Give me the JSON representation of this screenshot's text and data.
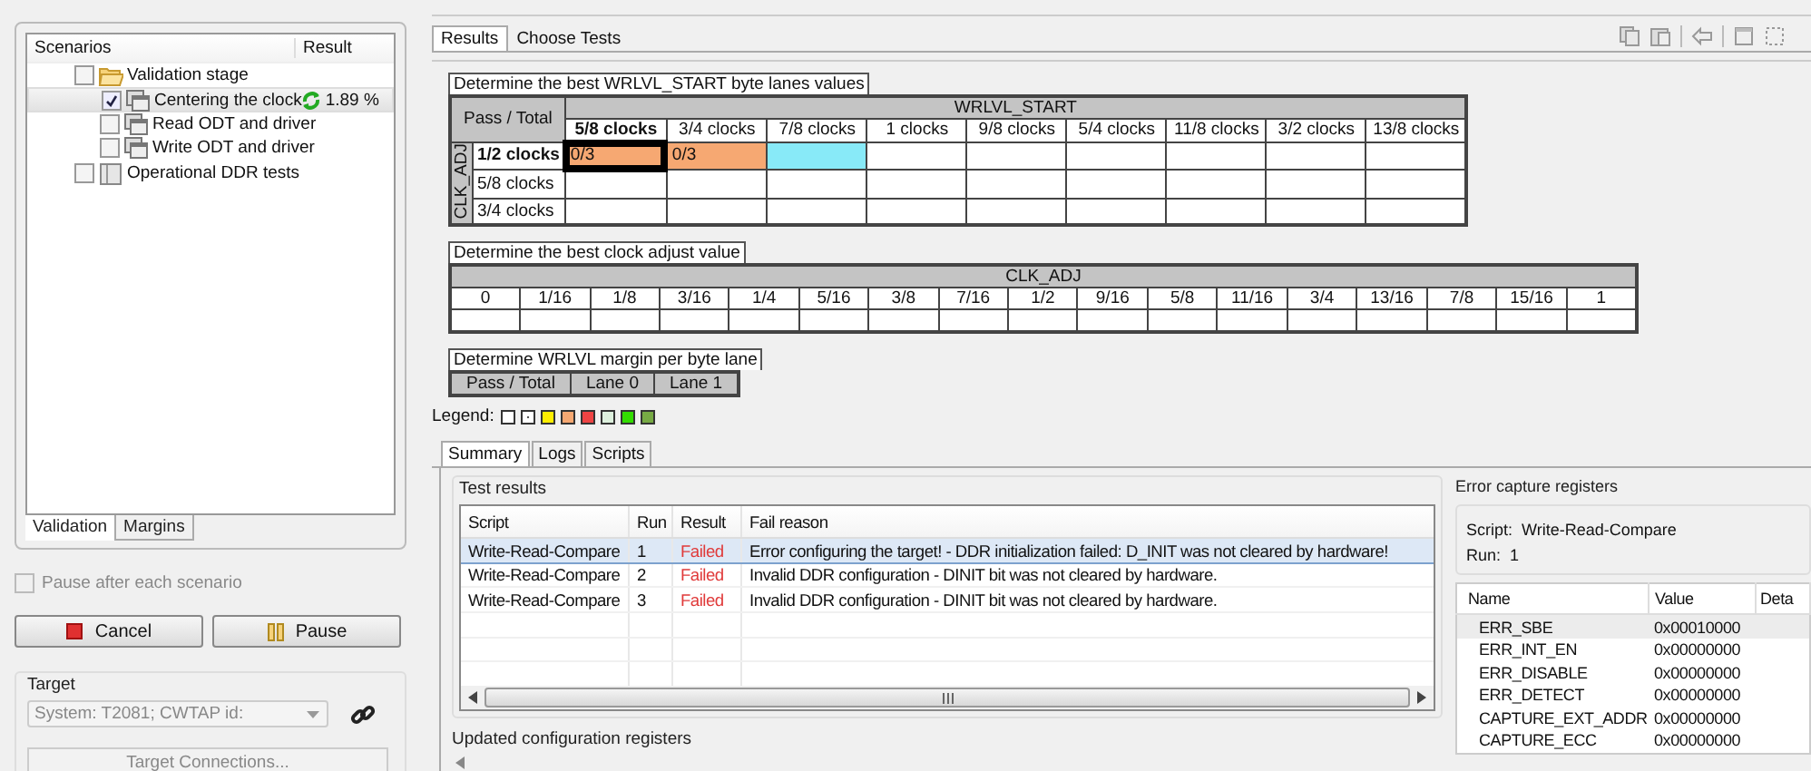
{
  "scenarios": {
    "columns": [
      "Scenarios",
      "Result"
    ],
    "items": [
      {
        "label": "Validation stage",
        "kind": "folder",
        "checked": false,
        "selected": false,
        "children": [
          {
            "label": "Centering the clock",
            "kind": "group",
            "checked": true,
            "selected": true,
            "result": "1.89 %",
            "running": true
          },
          {
            "label": "Read ODT and driver",
            "kind": "group",
            "checked": false,
            "selected": false
          },
          {
            "label": "Write ODT and driver",
            "kind": "group",
            "checked": false,
            "selected": false
          }
        ]
      },
      {
        "label": "Operational DDR tests",
        "kind": "suite",
        "checked": false,
        "selected": false
      }
    ]
  },
  "left_tabs": [
    {
      "label": "Validation",
      "selected": true
    },
    {
      "label": "Margins",
      "selected": false
    }
  ],
  "pause_option": {
    "label": "Pause after each scenario",
    "checked": false,
    "disabled": true
  },
  "buttons": [
    {
      "label": "Cancel",
      "kind": "stop"
    },
    {
      "label": "Pause",
      "kind": "pause"
    }
  ],
  "target": {
    "title": "Target",
    "system": "System: T2081; CWTAP id:",
    "connections_button": "Target Connections..."
  },
  "main_tabs": [
    {
      "label": "Results",
      "selected": true
    },
    {
      "label": "Choose Tests",
      "selected": false
    }
  ],
  "wrlvl_table": {
    "title": "Determine the best WRLVL_START byte lanes values",
    "corner": "Pass / Total",
    "column_group": "WRLVL_START",
    "row_group": "CLK_ADJ",
    "columns": [
      {
        "label": "5/8 clocks",
        "current": true
      },
      {
        "label": "3/4 clocks",
        "current": false
      },
      {
        "label": "7/8 clocks",
        "current": false
      },
      {
        "label": "1 clocks",
        "current": false
      },
      {
        "label": "9/8 clocks",
        "current": false
      },
      {
        "label": "5/4 clocks",
        "current": false
      },
      {
        "label": "11/8 clocks",
        "current": false
      },
      {
        "label": "3/2 clocks",
        "current": false
      },
      {
        "label": "13/8 clocks",
        "current": false
      }
    ],
    "rows": [
      {
        "label": "1/2 clocks",
        "current": true,
        "cells": [
          {
            "text": "0/3",
            "color": "#f6a872",
            "selected": true
          },
          {
            "text": "0/3",
            "color": "#f6a872",
            "selected": false
          },
          {
            "color": "#88eaf8",
            "selected": false
          },
          {
            "selected": false
          },
          {
            "selected": false
          },
          {
            "selected": false
          },
          {
            "selected": false
          },
          {
            "selected": false
          },
          {
            "selected": false
          }
        ]
      },
      {
        "label": "5/8 clocks",
        "current": false,
        "cells": [
          {
            "selected": false
          },
          {
            "selected": false
          },
          {
            "selected": false
          },
          {
            "selected": false
          },
          {
            "selected": false
          },
          {
            "selected": false
          },
          {
            "selected": false
          },
          {
            "selected": false
          },
          {
            "selected": false
          }
        ]
      },
      {
        "label": "3/4 clocks",
        "current": false,
        "cells": [
          {
            "selected": false
          },
          {
            "selected": false
          },
          {
            "selected": false
          },
          {
            "selected": false
          },
          {
            "selected": false
          },
          {
            "selected": false
          },
          {
            "selected": false
          },
          {
            "selected": false
          },
          {
            "selected": false
          }
        ]
      }
    ]
  },
  "clk_adj_table": {
    "title": "Determine the best clock adjust value",
    "column_group": "CLK_ADJ",
    "columns": [
      "0",
      "1/16",
      "1/8",
      "3/16",
      "1/4",
      "5/16",
      "3/8",
      "7/16",
      "1/2",
      "9/16",
      "5/8",
      "11/16",
      "3/4",
      "13/16",
      "7/8",
      "15/16",
      "1"
    ]
  },
  "margin_table": {
    "title": "Determine WRLVL margin per byte lane",
    "columns": [
      "Pass / Total",
      "Lane 0",
      "Lane 1"
    ]
  },
  "legend": {
    "label": "Legend:",
    "items": [
      {
        "kind": "plain",
        "color": "#ffffff"
      },
      {
        "kind": "dotted",
        "color": "#ffffff"
      },
      {
        "kind": "plain",
        "color": "#ffee00"
      },
      {
        "kind": "plain",
        "color": "#f6a872"
      },
      {
        "kind": "plain",
        "color": "#ee4444"
      },
      {
        "kind": "plain",
        "color": "#ddf0dd"
      },
      {
        "kind": "plain",
        "color": "#33dd00"
      },
      {
        "kind": "plain",
        "color": "#77aa44"
      }
    ]
  },
  "bottom_tabs": [
    {
      "label": "Summary",
      "selected": true
    },
    {
      "label": "Logs",
      "selected": false
    },
    {
      "label": "Scripts",
      "selected": false
    }
  ],
  "test_results": {
    "title": "Test results",
    "columns": [
      "Script",
      "Run",
      "Result",
      "Fail reason"
    ],
    "rows": [
      {
        "script": "Write-Read-Compare",
        "run": "1",
        "result": "Failed",
        "fail_reason": "Error configuring the target! - DDR initialization failed: D_INIT was not cleared by hardware!",
        "selected": true
      },
      {
        "script": "Write-Read-Compare",
        "run": "2",
        "result": "Failed",
        "fail_reason": "Invalid DDR configuration - DINIT bit was not cleared by hardware.",
        "selected": false
      },
      {
        "script": "Write-Read-Compare",
        "run": "3",
        "result": "Failed",
        "fail_reason": "Invalid DDR configuration - DINIT bit was not cleared by hardware.",
        "selected": false
      }
    ]
  },
  "updated_registers": {
    "title": "Updated configuration registers"
  },
  "error_capture": {
    "title": "Error capture registers",
    "script_label": "Script:",
    "script": "Write-Read-Compare",
    "run_label": "Run:",
    "run": "1",
    "columns": [
      "Name",
      "Value",
      "Deta"
    ],
    "rows": [
      {
        "name": "ERR_SBE",
        "value": "0x00010000",
        "selected": true
      },
      {
        "name": "ERR_INT_EN",
        "value": "0x00000000",
        "selected": false
      },
      {
        "name": "ERR_DISABLE",
        "value": "0x00000000",
        "selected": false
      },
      {
        "name": "ERR_DETECT",
        "value": "0x00000000",
        "selected": false
      },
      {
        "name": "CAPTURE_EXT_ADDR",
        "value": "0x00000000",
        "selected": false
      },
      {
        "name": "CAPTURE_ECC",
        "value": "0x00000000",
        "selected": false
      }
    ]
  }
}
